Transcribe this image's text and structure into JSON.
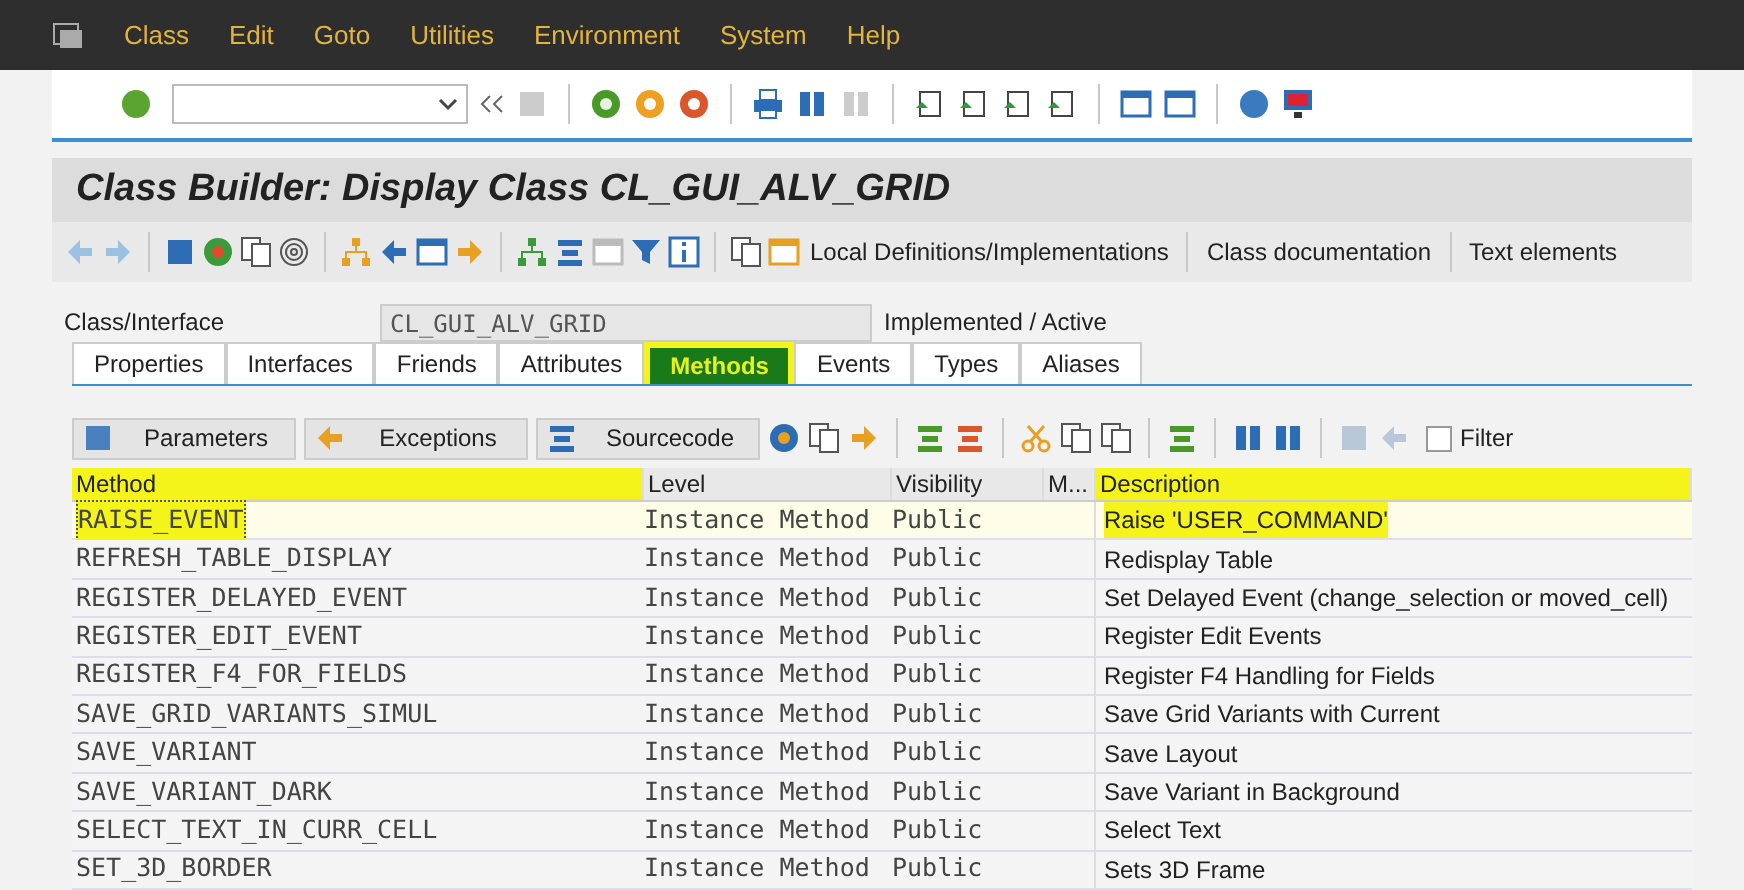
{
  "menu_bar": {
    "items": [
      "Class",
      "Edit",
      "Goto",
      "Utilities",
      "Environment",
      "System",
      "Help"
    ]
  },
  "title": "Class Builder: Display Class CL_GUI_ALV_GRID",
  "app_toolbar": {
    "buttons": [
      "Local Definitions/Implementations",
      "Class documentation",
      "Text elements"
    ]
  },
  "header": {
    "label": "Class/Interface",
    "value": "CL_GUI_ALV_GRID",
    "status": "Implemented / Active"
  },
  "tabs": [
    {
      "label": "Properties",
      "selected": false,
      "highlighted": false
    },
    {
      "label": "Interfaces",
      "selected": false,
      "highlighted": false
    },
    {
      "label": "Friends",
      "selected": false,
      "highlighted": false
    },
    {
      "label": "Attributes",
      "selected": false,
      "highlighted": false
    },
    {
      "label": "Methods",
      "selected": true,
      "highlighted": true
    },
    {
      "label": "Events",
      "selected": false,
      "highlighted": false
    },
    {
      "label": "Types",
      "selected": false,
      "highlighted": false
    },
    {
      "label": "Aliases",
      "selected": false,
      "highlighted": false
    }
  ],
  "method_toolbar": {
    "buttons": [
      "Parameters",
      "Exceptions",
      "Sourcecode"
    ],
    "filter": {
      "label": "Filter",
      "checked": false
    }
  },
  "table": {
    "columns": [
      {
        "label": "Method",
        "highlighted": true
      },
      {
        "label": "Level",
        "highlighted": false
      },
      {
        "label": "Visibility",
        "highlighted": false
      },
      {
        "label": "M...",
        "highlighted": false
      },
      {
        "label": "Description",
        "highlighted": true
      }
    ],
    "rows": [
      {
        "method": "RAISE_EVENT",
        "level": "Instance Method",
        "visibility": "Public",
        "description": "Raise 'USER_COMMAND'",
        "selected": true,
        "highlighted": true
      },
      {
        "method": "REFRESH_TABLE_DISPLAY",
        "level": "Instance Method",
        "visibility": "Public",
        "description": "Redisplay Table",
        "selected": false,
        "highlighted": false
      },
      {
        "method": "REGISTER_DELAYED_EVENT",
        "level": "Instance Method",
        "visibility": "Public",
        "description": "Set Delayed Event (change_selection or moved_cell)",
        "selected": false,
        "highlighted": false
      },
      {
        "method": "REGISTER_EDIT_EVENT",
        "level": "Instance Method",
        "visibility": "Public",
        "description": "Register Edit Events",
        "selected": false,
        "highlighted": false
      },
      {
        "method": "REGISTER_F4_FOR_FIELDS",
        "level": "Instance Method",
        "visibility": "Public",
        "description": "Register F4 Handling for Fields",
        "selected": false,
        "highlighted": false
      },
      {
        "method": "SAVE_GRID_VARIANTS_SIMUL",
        "level": "Instance Method",
        "visibility": "Public",
        "description": "Save Grid Variants with Current",
        "selected": false,
        "highlighted": false
      },
      {
        "method": "SAVE_VARIANT",
        "level": "Instance Method",
        "visibility": "Public",
        "description": "Save Layout",
        "selected": false,
        "highlighted": false
      },
      {
        "method": "SAVE_VARIANT_DARK",
        "level": "Instance Method",
        "visibility": "Public",
        "description": "Save Variant in Background",
        "selected": false,
        "highlighted": false
      },
      {
        "method": "SELECT_TEXT_IN_CURR_CELL",
        "level": "Instance Method",
        "visibility": "Public",
        "description": "Select Text",
        "selected": false,
        "highlighted": false
      },
      {
        "method": "SET_3D_BORDER",
        "level": "Instance Method",
        "visibility": "Public",
        "description": "Sets 3D Frame",
        "selected": false,
        "highlighted": false
      }
    ]
  }
}
